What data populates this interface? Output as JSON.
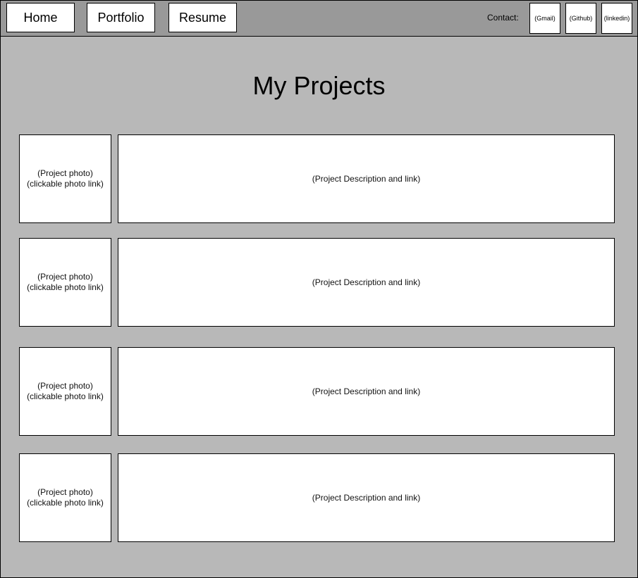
{
  "nav": {
    "home": "Home",
    "portfolio": "Portfolio",
    "resume": "Resume"
  },
  "contact": {
    "label": "Contact:",
    "gmail": "(Gmail)",
    "github": "(Github)",
    "linkedin": "(linkedin)"
  },
  "page": {
    "title": "My Projects"
  },
  "projects": [
    {
      "photo_line1": "(Project photo)",
      "photo_line2": "(clickable photo link)",
      "description": "(Project Description and link)"
    },
    {
      "photo_line1": "(Project photo)",
      "photo_line2": "(clickable photo link)",
      "description": "(Project Description and link)"
    },
    {
      "photo_line1": "(Project photo)",
      "photo_line2": "(clickable photo link)",
      "description": "(Project Description and link)"
    },
    {
      "photo_line1": "(Project photo)",
      "photo_line2": "(clickable photo link)",
      "description": "(Project Description and link)"
    }
  ],
  "colors": {
    "background": "#b8b8b8",
    "topbar": "#999999",
    "box": "#ffffff",
    "border": "#000000"
  }
}
